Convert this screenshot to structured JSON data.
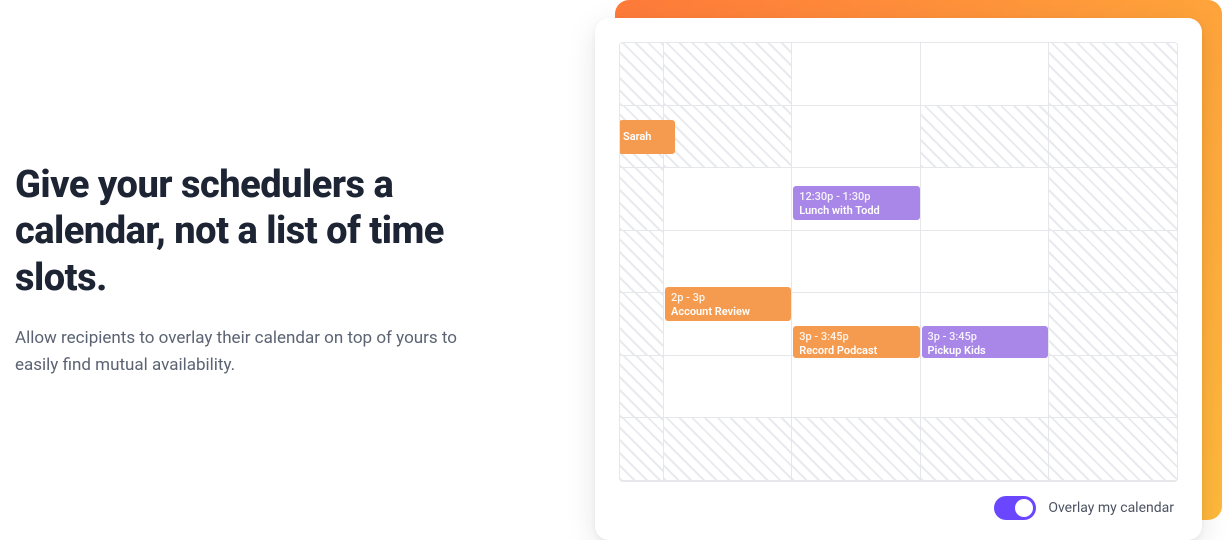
{
  "headline": "Give your schedulers a calendar, not a list of time slots.",
  "subtext": "Allow recipients to overlay their calendar on top of yours to easily find mutual availability.",
  "events": {
    "sarah": {
      "title": "Sarah"
    },
    "lunch": {
      "time": "12:30p - 1:30p",
      "title": "Lunch with Todd"
    },
    "account": {
      "time": "2p - 3p",
      "title": "Account Review"
    },
    "record": {
      "time": "3p - 3:45p",
      "title": "Record Podcast"
    },
    "pickup": {
      "time": "3p - 3:45p",
      "title": "Pickup Kids"
    }
  },
  "toggle": {
    "label": "Overlay my calendar",
    "on": true
  },
  "colors": {
    "orange": "#f59b50",
    "purple": "#a987e8",
    "toggleAccent": "#6b46ff"
  }
}
